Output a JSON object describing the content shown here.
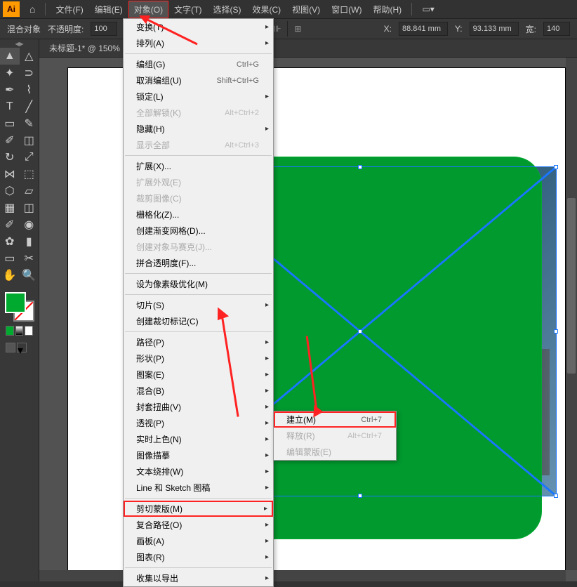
{
  "app_logo": "Ai",
  "menubar": [
    "文件(F)",
    "编辑(E)",
    "对象(O)",
    "文字(T)",
    "选择(S)",
    "效果(C)",
    "视图(V)",
    "窗口(W)",
    "帮助(H)"
  ],
  "menubar_active_index": 2,
  "controlbar": {
    "blend_label": "混合对象",
    "opacity_label": "不透明度:",
    "opacity_value": "100",
    "x_label": "X:",
    "x_value": "88.841 mm",
    "y_label": "Y:",
    "y_value": "93.133 mm",
    "w_label": "宽:",
    "w_value": "140"
  },
  "doc_tab": "未标题-1* @ 150%",
  "object_menu": [
    {
      "label": "变换(T)",
      "sub": true
    },
    {
      "label": "排列(A)",
      "sub": true
    },
    {
      "sep": true
    },
    {
      "label": "编组(G)",
      "shortcut": "Ctrl+G"
    },
    {
      "label": "取消编组(U)",
      "shortcut": "Shift+Ctrl+G"
    },
    {
      "label": "锁定(L)",
      "sub": true
    },
    {
      "label": "全部解锁(K)",
      "shortcut": "Alt+Ctrl+2",
      "disabled": true
    },
    {
      "label": "隐藏(H)",
      "sub": true
    },
    {
      "label": "显示全部",
      "shortcut": "Alt+Ctrl+3",
      "disabled": true
    },
    {
      "sep": true
    },
    {
      "label": "扩展(X)..."
    },
    {
      "label": "扩展外观(E)",
      "disabled": true
    },
    {
      "label": "裁剪图像(C)",
      "disabled": true
    },
    {
      "label": "栅格化(Z)..."
    },
    {
      "label": "创建渐变网格(D)..."
    },
    {
      "label": "创建对象马赛克(J)...",
      "disabled": true
    },
    {
      "label": "拼合透明度(F)..."
    },
    {
      "sep": true
    },
    {
      "label": "设为像素级优化(M)"
    },
    {
      "sep": true
    },
    {
      "label": "切片(S)",
      "sub": true
    },
    {
      "label": "创建裁切标记(C)"
    },
    {
      "sep": true
    },
    {
      "label": "路径(P)",
      "sub": true
    },
    {
      "label": "形状(P)",
      "sub": true
    },
    {
      "label": "图案(E)",
      "sub": true
    },
    {
      "label": "混合(B)",
      "sub": true
    },
    {
      "label": "封套扭曲(V)",
      "sub": true
    },
    {
      "label": "透视(P)",
      "sub": true
    },
    {
      "label": "实时上色(N)",
      "sub": true
    },
    {
      "label": "图像描摹",
      "sub": true
    },
    {
      "label": "文本绕排(W)",
      "sub": true
    },
    {
      "label": "Line 和 Sketch 图稿",
      "sub": true
    },
    {
      "sep": true
    },
    {
      "label": "剪切蒙版(M)",
      "sub": true,
      "highlighted": true
    },
    {
      "label": "复合路径(O)",
      "sub": true
    },
    {
      "label": "画板(A)",
      "sub": true
    },
    {
      "label": "图表(R)",
      "sub": true
    },
    {
      "sep": true
    },
    {
      "label": "收集以导出",
      "sub": true
    }
  ],
  "submenu": [
    {
      "label": "建立(M)",
      "shortcut": "Ctrl+7",
      "highlighted": true
    },
    {
      "label": "释放(R)",
      "shortcut": "Alt+Ctrl+7",
      "disabled": true
    },
    {
      "label": "编辑蒙版(E)",
      "disabled": true
    }
  ]
}
